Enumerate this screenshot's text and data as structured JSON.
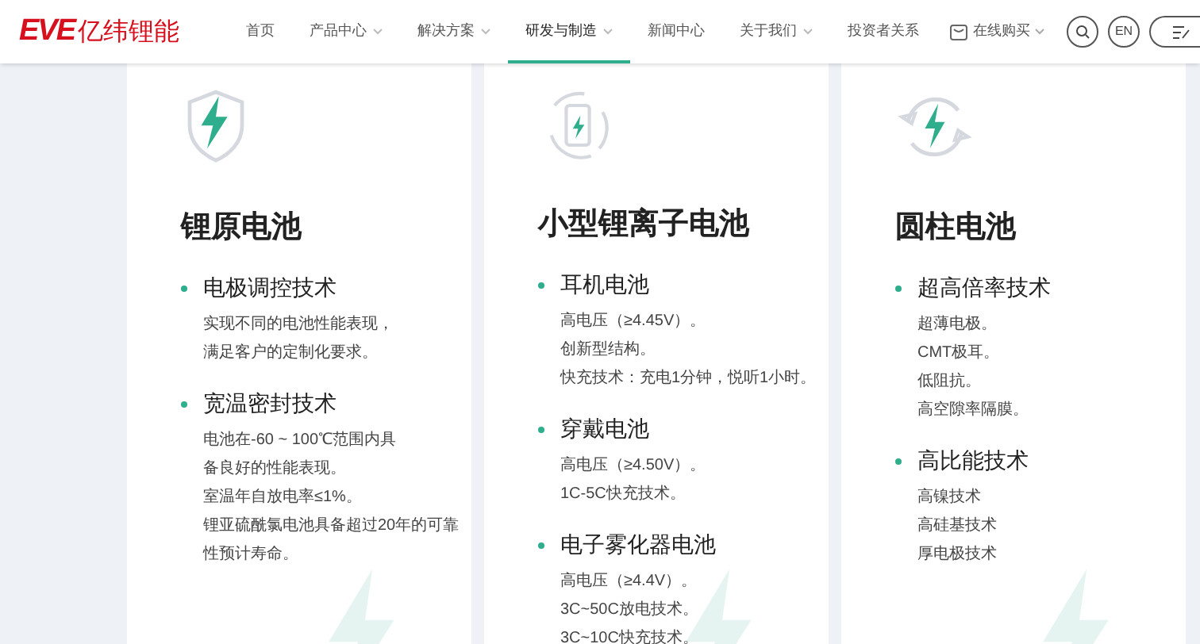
{
  "header": {
    "logo_mark": "EVE",
    "logo_text": "亿纬锂能",
    "nav": [
      {
        "label": "首页",
        "caret": false,
        "selected": false
      },
      {
        "label": "产品中心",
        "caret": true,
        "selected": false
      },
      {
        "label": "解决方案",
        "caret": true,
        "selected": false
      },
      {
        "label": "研发与制造",
        "caret": true,
        "selected": true
      },
      {
        "label": "新闻中心",
        "caret": false,
        "selected": false
      },
      {
        "label": "关于我们",
        "caret": true,
        "selected": false
      },
      {
        "label": "投资者关系",
        "caret": false,
        "selected": false
      }
    ],
    "shop": {
      "label": "在线购买",
      "caret": true
    },
    "lang": "EN"
  },
  "cards": [
    {
      "kind": "shield",
      "title": "锂原电池",
      "sections": [
        {
          "heading": "电极调控技术",
          "lines": [
            "实现不同的电池性能表现，",
            "满足客户的定制化要求。"
          ]
        },
        {
          "heading": "宽温密封技术",
          "lines": [
            "电池在-60 ~ 100℃范围内具",
            "备良好的性能表现。",
            "室温年自放电率≤1%。",
            "锂亚硫酰氯电池具备超过20年的可靠",
            "性预计寿命。"
          ]
        }
      ]
    },
    {
      "kind": "battery",
      "title": "小型锂离子电池",
      "sections": [
        {
          "heading": "耳机电池",
          "lines": [
            "高电压（≥4.45V）。",
            "创新型结构。",
            "快充技术：充电1分钟，悦听1小时。"
          ]
        },
        {
          "heading": "穿戴电池",
          "lines": [
            "高电压（≥4.50V）。",
            "1C-5C快充技术。"
          ]
        },
        {
          "heading": "电子雾化器电池",
          "lines": [
            "高电压（≥4.4V）。",
            "3C~50C放电技术。",
            "3C~10C快充技术。"
          ]
        }
      ]
    },
    {
      "kind": "cycle",
      "title": "圆柱电池",
      "sections": [
        {
          "heading": "超高倍率技术",
          "lines": [
            "超薄电极。",
            "CMT极耳。",
            "低阻抗。",
            "高空隙率隔膜。"
          ]
        },
        {
          "heading": "高比能技术",
          "lines": [
            "高镍技术",
            "高硅基技术",
            "厚电极技术"
          ]
        }
      ]
    }
  ]
}
